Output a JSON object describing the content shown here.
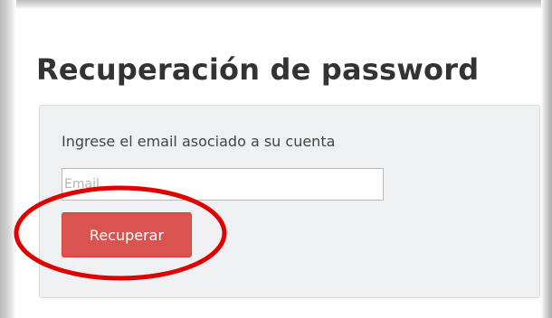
{
  "page": {
    "title": "Recuperación de password"
  },
  "form": {
    "instruction": "Ingrese el email asociado a su cuenta",
    "email_placeholder": "Email",
    "email_value": "",
    "submit_label": "Recuperar"
  },
  "colors": {
    "button_background": "#d9534f",
    "panel_background": "#eef0f1",
    "annotation_circle": "#e00000"
  }
}
